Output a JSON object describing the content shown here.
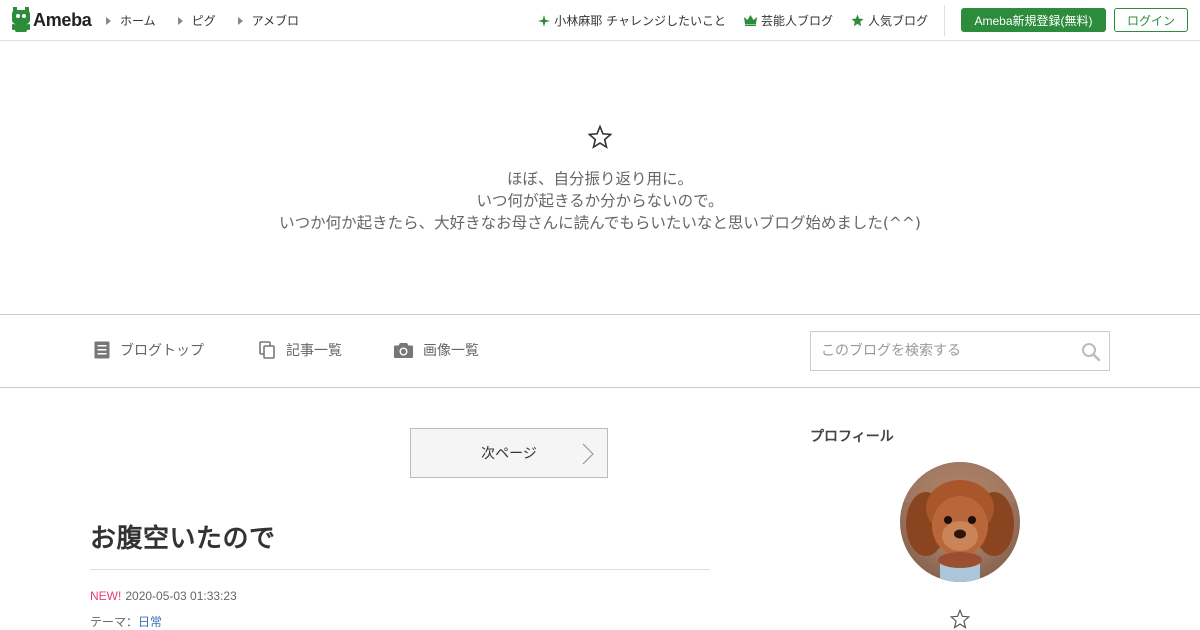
{
  "header": {
    "logo_text": "Ameba",
    "nav_left": [
      {
        "label": "ホーム"
      },
      {
        "label": "ピグ"
      },
      {
        "label": "アメブロ"
      }
    ],
    "nav_right": [
      {
        "label": "小林麻耶 チャレンジしたいこと",
        "icon": "sparkle-icon"
      },
      {
        "label": "芸能人ブログ",
        "icon": "crown-icon"
      },
      {
        "label": "人気ブログ",
        "icon": "star-icon"
      }
    ],
    "register_label": "Ameba新規登録(無料)",
    "login_label": "ログイン"
  },
  "hero": {
    "icon": "star-outline-icon",
    "description_lines": [
      "ほぼ、自分振り返り用に。",
      "いつ何が起きるか分からないので。",
      "いつか何か起きたら、大好きなお母さんに読んでもらいたいなと思いブログ始めました(^^)"
    ]
  },
  "blog_nav": {
    "items": [
      {
        "label": "ブログトップ",
        "icon": "document-icon"
      },
      {
        "label": "記事一覧",
        "icon": "copy-icon"
      },
      {
        "label": "画像一覧",
        "icon": "camera-icon"
      }
    ],
    "search_placeholder": "このブログを検索する"
  },
  "main": {
    "next_page_label": "次ページ",
    "entry": {
      "title": "お腹空いたので",
      "new_badge": "NEW!",
      "datetime": "2020-05-03 01:33:23",
      "theme_label": "テーマ：",
      "theme_value": "日常"
    }
  },
  "sidebar": {
    "heading": "プロフィール",
    "star_icon": "star-outline-icon"
  },
  "colors": {
    "brand_green": "#2d8c3c",
    "new_pink": "#e73c7e",
    "link_blue": "#3d6fb6"
  }
}
